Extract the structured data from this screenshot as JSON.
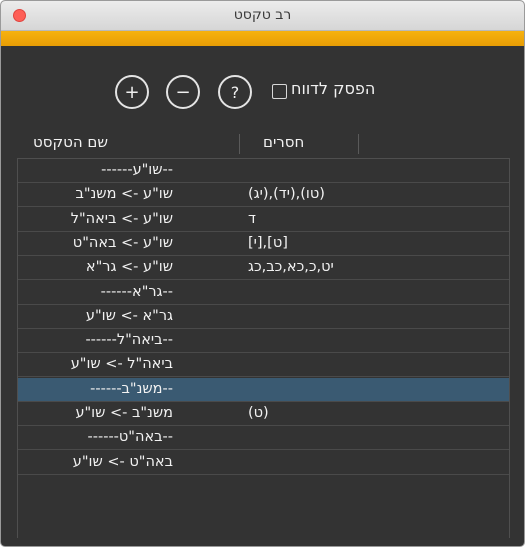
{
  "window": {
    "title": "רב טקסט"
  },
  "toolbar": {
    "add_label": "+",
    "remove_label": "−",
    "help_label": "?",
    "checkbox_label": "הפסק לדווח",
    "checkbox_checked": false
  },
  "table": {
    "columns": [
      "שם הטקסט",
      "חסרים"
    ],
    "rows": [
      {
        "name": "--שו\"ע------",
        "missing": ""
      },
      {
        "name": "שו\"ע -> משנ\"ב",
        "missing": "(טו),(יד),(יג)"
      },
      {
        "name": "שו\"ע -> ביאה\"ל",
        "missing": "ד"
      },
      {
        "name": "שו\"ע -> באה\"ט",
        "missing": "[ט],[י]"
      },
      {
        "name": "שו\"ע -> גר\"א",
        "missing": "יט,כ,כא,כב,כג"
      },
      {
        "name": "--גר\"א------",
        "missing": ""
      },
      {
        "name": "גר\"א -> שו\"ע",
        "missing": ""
      },
      {
        "name": "--ביאה\"ל------",
        "missing": ""
      },
      {
        "name": "ביאה\"ל -> שו\"ע",
        "missing": ""
      },
      {
        "name": "--משנ\"ב------",
        "missing": ""
      },
      {
        "name": "משנ\"ב -> שו\"ע",
        "missing": "(ט)"
      },
      {
        "name": "--באה\"ט------",
        "missing": ""
      },
      {
        "name": "באה\"ט -> שו\"ע",
        "missing": ""
      }
    ],
    "selected_index": 9
  },
  "colors": {
    "accent": "#f0a80a",
    "background": "#333333",
    "selection": "#3a5a72"
  }
}
